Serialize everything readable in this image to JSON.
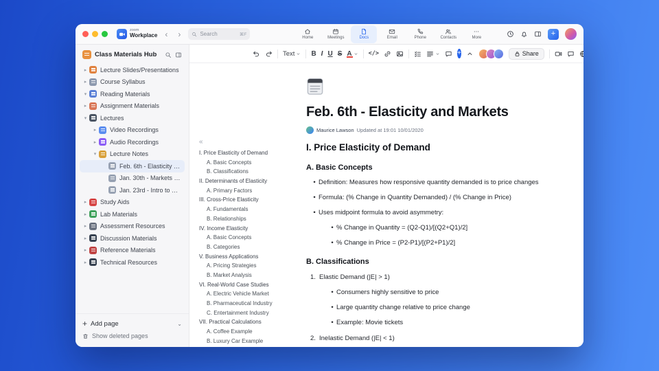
{
  "titlebar": {
    "brand_top": "zoom",
    "brand_bottom": "Workplace",
    "search": {
      "placeholder": "Search",
      "shortcut": "⌘F"
    },
    "tabs": [
      {
        "id": "home",
        "label": "Home",
        "active": false
      },
      {
        "id": "meetings",
        "label": "Meetings",
        "active": false
      },
      {
        "id": "docs",
        "label": "Docs",
        "active": true
      },
      {
        "id": "email",
        "label": "Email",
        "active": false
      },
      {
        "id": "phone",
        "label": "Phone",
        "active": false
      },
      {
        "id": "contacts",
        "label": "Contacts",
        "active": false
      },
      {
        "id": "more",
        "label": "More",
        "active": false
      }
    ]
  },
  "sidebar": {
    "title": "Class Materials Hub",
    "items": [
      {
        "label": "Lecture Slides/Presentations",
        "level": 1,
        "chevron": "right",
        "icon": "slides",
        "color": "#e0823f",
        "selected": false
      },
      {
        "label": "Course Syllabus",
        "level": 1,
        "chevron": "right",
        "icon": "syllabus",
        "color": "#8d99ae",
        "selected": false
      },
      {
        "label": "Reading Materials",
        "level": 1,
        "chevron": "down",
        "icon": "book",
        "color": "#5a7fd6",
        "selected": false
      },
      {
        "label": "Assignment Materials",
        "level": 1,
        "chevron": "right",
        "icon": "assignment",
        "color": "#d97757",
        "selected": false
      },
      {
        "label": "Lectures",
        "level": 1,
        "chevron": "down",
        "icon": "lectures",
        "color": "#4b5563",
        "selected": false
      },
      {
        "label": "Video Recordings",
        "level": 2,
        "chevron": "right",
        "icon": "video",
        "color": "#5b8def",
        "selected": false
      },
      {
        "label": "Audio Recordings",
        "level": 2,
        "chevron": "right",
        "icon": "audio",
        "color": "#8b5cf6",
        "selected": false
      },
      {
        "label": "Lecture Notes",
        "level": 2,
        "chevron": "down",
        "icon": "notes",
        "color": "#d9a13b",
        "selected": false
      },
      {
        "label": "Feb. 6th - Elasticity and M...",
        "level": 3,
        "chevron": "none",
        "icon": "doc",
        "color": "#98a2b3",
        "selected": true
      },
      {
        "label": "Jan. 30th - Markets and P...",
        "level": 3,
        "chevron": "none",
        "icon": "doc",
        "color": "#98a2b3",
        "selected": false
      },
      {
        "label": "Jan. 23rd - Intro to Econo...",
        "level": 3,
        "chevron": "none",
        "icon": "doc",
        "color": "#98a2b3",
        "selected": false
      },
      {
        "label": "Study Aids",
        "level": 1,
        "chevron": "right",
        "icon": "apple",
        "color": "#d64545",
        "selected": false
      },
      {
        "label": "Lab Materials",
        "level": 1,
        "chevron": "right",
        "icon": "lab",
        "color": "#3fa15b",
        "selected": false
      },
      {
        "label": "Assessment Resources",
        "level": 1,
        "chevron": "right",
        "icon": "chart",
        "color": "#6b7280",
        "selected": false
      },
      {
        "label": "Discussion Materials",
        "level": 1,
        "chevron": "right",
        "icon": "chat",
        "color": "#374151",
        "selected": false
      },
      {
        "label": "Reference Materials",
        "level": 1,
        "chevron": "right",
        "icon": "books",
        "color": "#c04444",
        "selected": false
      },
      {
        "label": "Technical Resources",
        "level": 1,
        "chevron": "right",
        "icon": "tools",
        "color": "#374151",
        "selected": false
      }
    ],
    "footer": {
      "add_page": "Add page",
      "show_deleted": "Show deleted pages"
    }
  },
  "toolbar": {
    "text_style_label": "Text",
    "bold": "B",
    "italic": "I",
    "underline": "U",
    "strikethrough": "S",
    "text_color": "A",
    "code": "</>",
    "share_label": "Share"
  },
  "document": {
    "title": "Feb. 6th - Elasticity and Markets",
    "author": "Maurice Lawson",
    "updated": "Updated at 19:01 10/01/2020",
    "outline": [
      {
        "level": 1,
        "text": "I. Price Elasticity of Demand"
      },
      {
        "level": 2,
        "text": "A. Basic Concepts"
      },
      {
        "level": 2,
        "text": "B. Classifications"
      },
      {
        "level": 1,
        "text": "II. Determinants of Elasticity"
      },
      {
        "level": 2,
        "text": "A. Primary Factors"
      },
      {
        "level": 1,
        "text": "III. Cross-Price Elasticity"
      },
      {
        "level": 2,
        "text": "A. Fundamentals"
      },
      {
        "level": 2,
        "text": "B. Relationships"
      },
      {
        "level": 1,
        "text": "IV. Income Elasticity"
      },
      {
        "level": 2,
        "text": "A. Basic Concepts"
      },
      {
        "level": 2,
        "text": "B. Categories"
      },
      {
        "level": 1,
        "text": "V. Business Applications"
      },
      {
        "level": 2,
        "text": "A. Pricing Strategies"
      },
      {
        "level": 2,
        "text": "B. Market Analysis"
      },
      {
        "level": 1,
        "text": "VI. Real-World Case Studies"
      },
      {
        "level": 2,
        "text": "A. Electric Vehicle Market"
      },
      {
        "level": 2,
        "text": "B. Pharmaceutical Industry"
      },
      {
        "level": 2,
        "text": "C. Entertainment Industry"
      },
      {
        "level": 1,
        "text": "VII. Practical Calculations"
      },
      {
        "level": 2,
        "text": "A. Coffee Example"
      },
      {
        "level": 2,
        "text": "B. Luxury Car Example"
      }
    ],
    "content": [
      {
        "type": "h2",
        "text": "I. Price Elasticity of Demand"
      },
      {
        "type": "h3",
        "text": "A. Basic Concepts"
      },
      {
        "type": "bullet",
        "level": 1,
        "text": "Definition: Measures how responsive quantity demanded is to price changes"
      },
      {
        "type": "bullet",
        "level": 1,
        "text": "Formula: (% Change in Quantity Demanded) / (% Change in Price)"
      },
      {
        "type": "bullet",
        "level": 1,
        "text": "Uses midpoint formula to avoid asymmetry:"
      },
      {
        "type": "bullet",
        "level": 2,
        "text": "% Change in Quantity = (Q2-Q1)/[(Q2+Q1)/2]"
      },
      {
        "type": "bullet",
        "level": 2,
        "text": "% Change in Price = (P2-P1)/[(P2+P1)/2]"
      },
      {
        "type": "h3",
        "text": "B. Classifications"
      },
      {
        "type": "numbered",
        "num": "1.",
        "text": "Elastic Demand (|E| > 1)"
      },
      {
        "type": "bullet",
        "level": 2,
        "text": "Consumers highly sensitive to price"
      },
      {
        "type": "bullet",
        "level": 2,
        "text": "Large quantity change relative to price change"
      },
      {
        "type": "bullet",
        "level": 2,
        "text": "Example: Movie tickets"
      },
      {
        "type": "numbered",
        "num": "2.",
        "text": "Inelastic Demand (|E| < 1)"
      }
    ]
  },
  "colors": {
    "accent_blue": "#2563eb",
    "active_tab_bg": "#e7effd",
    "selected_row_bg": "#e7edf9",
    "desktop_gradient_start": "#1b49c8",
    "desktop_gradient_end": "#4e8ef7"
  }
}
